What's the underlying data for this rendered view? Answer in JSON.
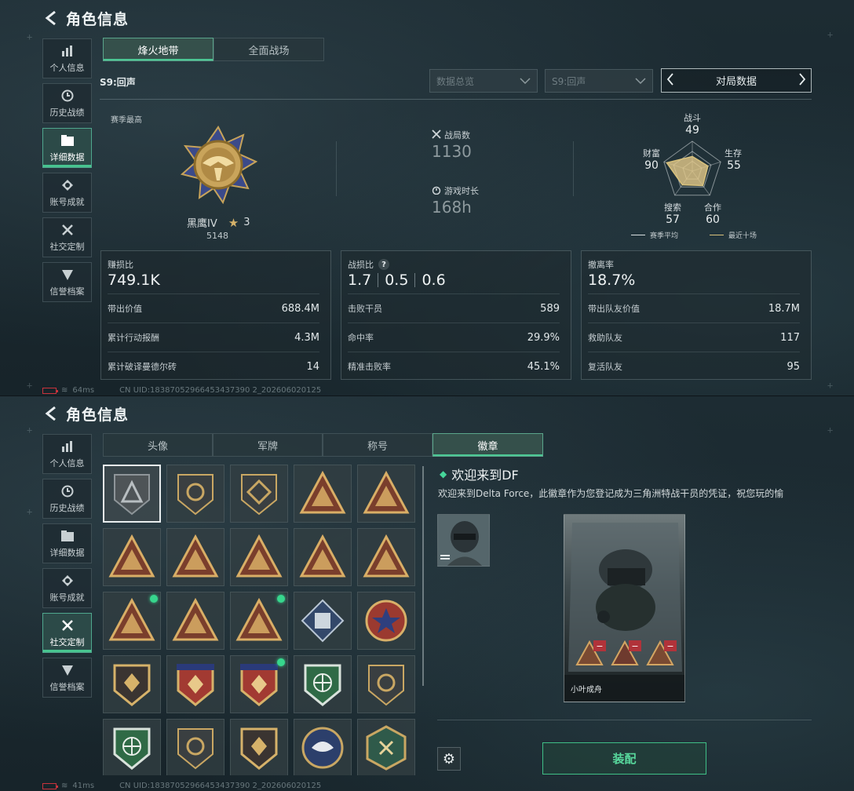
{
  "header": {
    "title": "角色信息"
  },
  "sidebar": {
    "items": [
      {
        "label": "个人信息",
        "icon": "bar-chart-icon"
      },
      {
        "label": "历史战绩",
        "icon": "clock-icon"
      },
      {
        "label": "详细数据",
        "icon": "folder-icon"
      },
      {
        "label": "账号成就",
        "icon": "medal-icon"
      },
      {
        "label": "社交定制",
        "icon": "tools-icon"
      },
      {
        "label": "信誉档案",
        "icon": "shield-icon"
      }
    ]
  },
  "top": {
    "tabs": [
      {
        "label": "烽火地带"
      },
      {
        "label": "全面战场"
      }
    ],
    "season_label": "S9:回声",
    "filters": {
      "overview": "数据总览",
      "season": "S9:回声",
      "pager": "对局数据"
    },
    "summary": {
      "label": "赛季最高",
      "rank_name": "黑鹰IV",
      "rank_stars": "3",
      "rank_score": "5148",
      "matches_label": "战局数",
      "matches_value": "1130",
      "playtime_label": "游戏时长",
      "playtime_value": "168h"
    },
    "radar": {
      "axes": [
        {
          "name": "战斗",
          "value": "49"
        },
        {
          "name": "生存",
          "value": "55"
        },
        {
          "name": "合作",
          "value": "60"
        },
        {
          "name": "搜索",
          "value": "57"
        },
        {
          "name": "财富",
          "value": "90"
        }
      ],
      "values": [
        49,
        55,
        60,
        57,
        90
      ],
      "legend_avg": "赛季平均",
      "legend_recent": "最近十场",
      "color_fill": "#e3c98a",
      "color_line": "#d9c27c"
    },
    "cards": {
      "profit": {
        "title": "赚损比",
        "value": "749.1K",
        "rows": [
          {
            "label": "带出价值",
            "value": "688.4M"
          },
          {
            "label": "累计行动报酬",
            "value": "4.3M"
          },
          {
            "label": "累计破译曼德尔砖",
            "value": "14"
          }
        ]
      },
      "combat": {
        "title": "战损比",
        "help": "?",
        "values": [
          "1.7",
          "0.5",
          "0.6"
        ],
        "rows": [
          {
            "label": "击败干员",
            "value": "589"
          },
          {
            "label": "命中率",
            "value": "29.9%"
          },
          {
            "label": "精准击败率",
            "value": "45.1%"
          }
        ]
      },
      "extract": {
        "title": "撤离率",
        "value": "18.7%",
        "rows": [
          {
            "label": "带出队友价值",
            "value": "18.7M"
          },
          {
            "label": "救助队友",
            "value": "117"
          },
          {
            "label": "复活队友",
            "value": "95"
          }
        ]
      }
    },
    "status": {
      "ping": "64ms",
      "uid": "CN UID:18387052966453437390 2_202606020125"
    }
  },
  "bottom": {
    "tabs": [
      {
        "label": "头像"
      },
      {
        "label": "军牌"
      },
      {
        "label": "称号"
      },
      {
        "label": "徽章"
      }
    ],
    "detail": {
      "title": "欢迎来到DF",
      "desc": "欢迎来到Delta Force，此徽章作为您登记成为三角洲特战干员的凭证，祝您玩的愉",
      "preview_name": "小叶成舟",
      "equip_label": "装配"
    },
    "status": {
      "ping": "41ms",
      "uid": "CN UID:18387052966453437390 2_202606020125"
    }
  }
}
